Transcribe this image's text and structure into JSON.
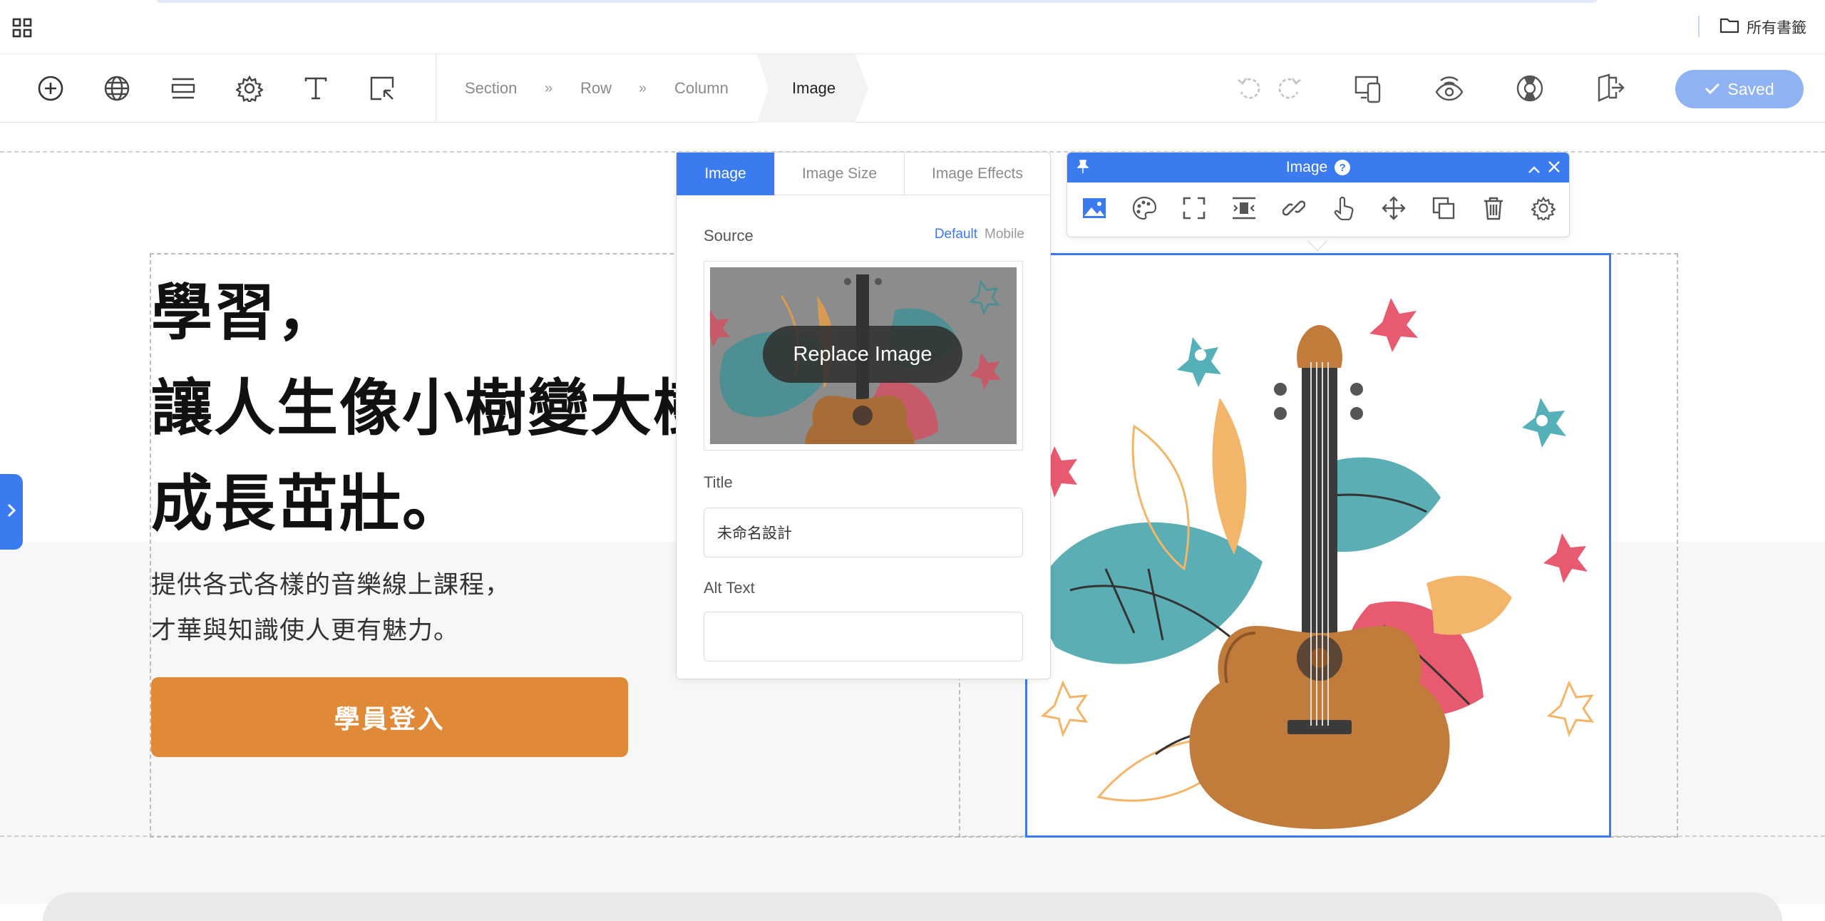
{
  "bookmarks": {
    "folder_label": "所有書籤"
  },
  "toolbar": {
    "left_icons": [
      "plus-circle-icon",
      "globe-icon",
      "layout-rows-icon",
      "gear-icon",
      "text-icon",
      "select-element-icon"
    ],
    "breadcrumb": {
      "section": "Section",
      "row": "Row",
      "column": "Column",
      "active": "Image",
      "separator": "»"
    },
    "right_icons": [
      "undo-icon",
      "redo-icon",
      "responsive-preview-icon",
      "preview-eye-icon",
      "help-lifebuoy-icon",
      "exit-icon"
    ],
    "saved_label": "Saved"
  },
  "page": {
    "headline_lines": [
      "學習，",
      "讓人生像小樹變大樹",
      "成長茁壯。"
    ],
    "sub_lines": [
      "提供各式各樣的音樂線上課程，",
      "才華與知識使人更有魅力。"
    ],
    "button_label": "學員登入"
  },
  "image_panel": {
    "tabs": [
      "Image",
      "Image Size",
      "Image Effects"
    ],
    "active_tab": "Image",
    "source_label": "Source",
    "source_default": "Default",
    "source_mobile": "Mobile",
    "replace_label": "Replace Image",
    "title_label": "Title",
    "title_value": "未命名設計",
    "alt_label": "Alt Text",
    "alt_value": ""
  },
  "image_toolbar": {
    "title": "Image",
    "help": "?",
    "icons": [
      "image-icon",
      "palette-icon",
      "fullscreen-icon",
      "align-icon",
      "link-icon",
      "pointer-hand-icon",
      "move-icon",
      "duplicate-icon",
      "trash-icon",
      "settings-icon"
    ]
  },
  "colors": {
    "accent": "#3a7bf0",
    "button": "#e08a38",
    "saved_button": "#8fb3f2"
  }
}
